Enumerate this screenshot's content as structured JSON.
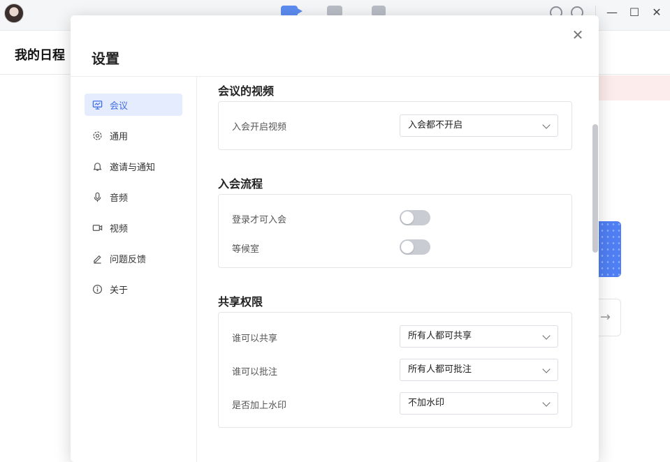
{
  "app": {
    "page_title": "我的日程"
  },
  "topbar": {
    "tabs": [
      {
        "icon": "video-camera-icon"
      },
      {
        "icon": "apps-grid-icon"
      },
      {
        "icon": "document-icon"
      }
    ],
    "right_icons": [
      "headset-icon",
      "gear-icon"
    ],
    "window_controls": {
      "minimize": "—",
      "maximize": "☐",
      "close": "✕"
    }
  },
  "background": {
    "arrow_glyph": "→"
  },
  "settings": {
    "title": "设置",
    "close_glyph": "✕",
    "nav": [
      {
        "label": "会议",
        "icon": "presentation-icon",
        "active": true
      },
      {
        "label": "通用",
        "icon": "gear-icon",
        "active": false
      },
      {
        "label": "邀请与通知",
        "icon": "bell-icon",
        "active": false
      },
      {
        "label": "音频",
        "icon": "microphone-icon",
        "active": false
      },
      {
        "label": "视频",
        "icon": "video-camera-icon",
        "active": false
      },
      {
        "label": "问题反馈",
        "icon": "pencil-icon",
        "active": false
      },
      {
        "label": "关于",
        "icon": "info-icon",
        "active": false
      }
    ],
    "sections": {
      "video": {
        "title": "会议的视频",
        "rows": [
          {
            "label": "入会开启视频",
            "value": "入会都不开启"
          }
        ]
      },
      "join_flow": {
        "title": "入会流程",
        "rows": [
          {
            "label": "登录才可入会",
            "on": false
          },
          {
            "label": "等候室",
            "on": false
          }
        ]
      },
      "share": {
        "title": "共享权限",
        "rows": [
          {
            "label": "谁可以共享",
            "value": "所有人都可共享"
          },
          {
            "label": "谁可以批注",
            "value": "所有人都可批注"
          },
          {
            "label": "是否加上水印",
            "value": "不加水印"
          }
        ]
      }
    }
  },
  "colors": {
    "accent": "#3f6ee8",
    "active_nav_bg": "#e4ecfd",
    "toggle_off": "#c9ccd2"
  }
}
